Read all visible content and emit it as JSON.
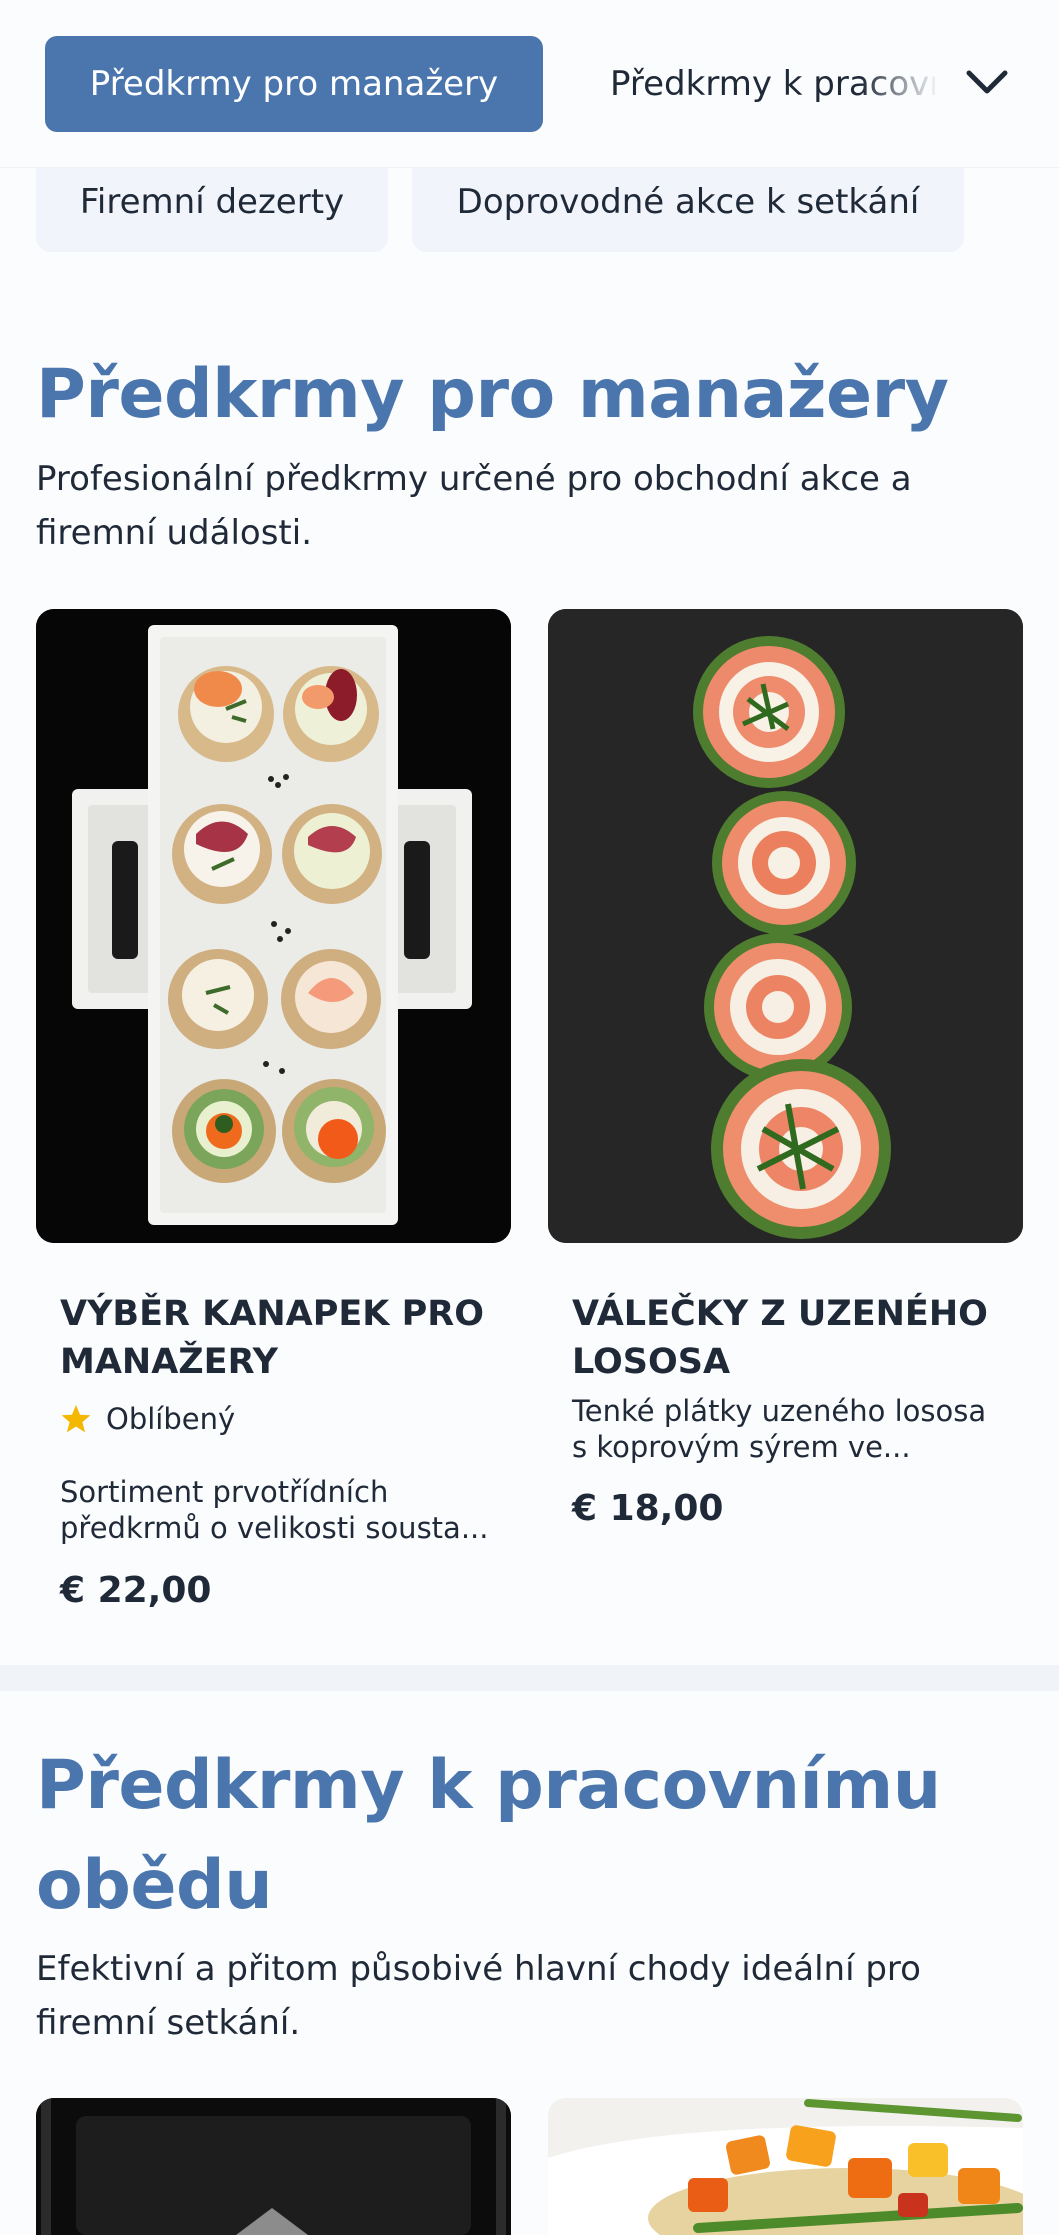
{
  "nav": {
    "active_tab": "Předkrmy pro manažery",
    "next_tab": "Předkrmy k pracovnímu obědu",
    "row2": [
      "Firemní dezerty",
      "Doprovodné akce k setkání"
    ]
  },
  "sections": [
    {
      "title": "Předkrmy pro manažery",
      "description": "Profesionální předkrmy určené pro obchodní akce a firemní události.",
      "products": [
        {
          "name": "VÝBĚR KANAPEK PRO MANAŽERY",
          "badge": "Oblíbený",
          "description": "Sortiment prvotřídních předkrmů o velikosti sousta...",
          "price": "€ 22,00"
        },
        {
          "name": "VÁLEČKY Z UZENÉHO LOSOSA",
          "description": "Tenké plátky uzeného lososa s koprovým sýrem ve...",
          "price": "€ 18,00"
        }
      ]
    },
    {
      "title_line1": "Předkrmy k pracovnímu",
      "title_line2": "obědu",
      "description": "Efektivní a přitom působivé hlavní chody ideální pro firemní setkání."
    }
  ],
  "colors": {
    "accent": "#4a76ad",
    "badge_star": "#f5b800",
    "text": "#1f2937",
    "chip_bg": "#f1f5fb"
  },
  "icons": {
    "chevron": "chevron-down-icon",
    "star": "star-icon"
  }
}
